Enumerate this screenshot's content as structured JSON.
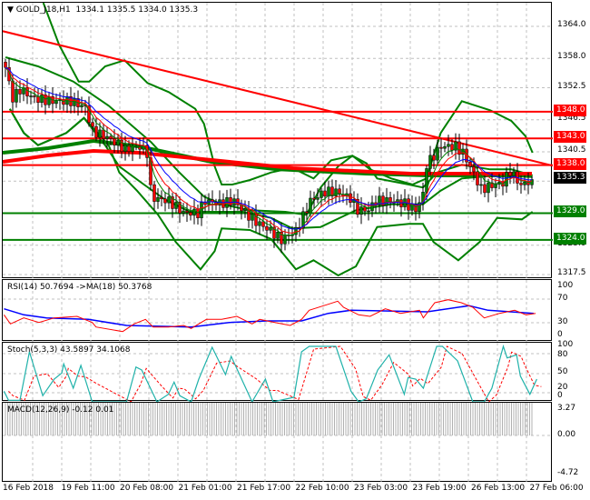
{
  "main": {
    "symbol_title": "GOLD_J18,H1",
    "ohlc": "1334.1 1335.5 1334.0 1335.3",
    "price_ticks": [
      "1364.0",
      "1358.0",
      "1352.5",
      "1346.5",
      "1340.5",
      "1323.0",
      "1317.5"
    ],
    "price_tick_values": [
      1364.0,
      1358.0,
      1352.5,
      1346.5,
      1340.5,
      1323.0,
      1317.5
    ],
    "levels": [
      {
        "label": "1348.0",
        "price": 1348.0,
        "color": "#ff0000"
      },
      {
        "label": "1343.0",
        "price": 1343.0,
        "color": "#ff0000"
      },
      {
        "label": "1338.0",
        "price": 1338.0,
        "color": "#ff0000"
      },
      {
        "label": "1329.0",
        "price": 1329.0,
        "color": "#008000"
      },
      {
        "label": "1324.0",
        "price": 1324.0,
        "color": "#008000"
      }
    ],
    "current_price": {
      "label": "1335.3",
      "price": 1335.3,
      "color": "#000000"
    },
    "close_keypoints": [
      [
        0,
        1356.3
      ],
      [
        2,
        1350.5
      ],
      [
        4,
        1352.2
      ],
      [
        8,
        1350.5
      ],
      [
        13,
        1350
      ],
      [
        18,
        1350
      ],
      [
        22,
        1348.8
      ],
      [
        24,
        1344.4
      ],
      [
        28,
        1343.2
      ],
      [
        33,
        1341
      ],
      [
        37,
        1341.5
      ],
      [
        39,
        1340.3
      ],
      [
        40,
        1333.5
      ],
      [
        41,
        1331.8
      ],
      [
        45,
        1331.3
      ],
      [
        49,
        1329.1
      ],
      [
        53,
        1329
      ],
      [
        55,
        1331.3
      ],
      [
        59,
        1330.8
      ],
      [
        63,
        1331.3
      ],
      [
        66,
        1329.1
      ],
      [
        69,
        1327.4
      ],
      [
        73,
        1325.7
      ],
      [
        76,
        1324
      ],
      [
        80,
        1325.7
      ],
      [
        82,
        1328.4
      ],
      [
        84,
        1331.3
      ],
      [
        88,
        1333
      ],
      [
        91,
        1333
      ],
      [
        95,
        1331.8
      ],
      [
        97,
        1329.6
      ],
      [
        100,
        1329.6
      ],
      [
        102,
        1331.3
      ],
      [
        106,
        1331.3
      ],
      [
        110,
        1330.8
      ],
      [
        113,
        1329.6
      ],
      [
        115,
        1332.5
      ],
      [
        116,
        1338.1
      ],
      [
        120,
        1341.5
      ],
      [
        124,
        1341.5
      ],
      [
        126,
        1340.3
      ],
      [
        129,
        1336.4
      ],
      [
        131,
        1333.5
      ],
      [
        134,
        1334.2
      ],
      [
        137,
        1334.7
      ],
      [
        139,
        1336.9
      ],
      [
        142,
        1334.2
      ],
      [
        145,
        1335.3
      ]
    ],
    "colors": {
      "bull": "#008000",
      "bear": "#ff0000",
      "bands": "#008000",
      "trend": "#ff0000"
    }
  },
  "rsi": {
    "title": "RSI(14) 50.7694  ->MA(18) 50.3768",
    "ticks": [
      "100",
      "70",
      "30",
      "0"
    ]
  },
  "stoch": {
    "title": "Stoch(5,3,3) 43.5897 34.1068",
    "ticks": [
      "100",
      "80",
      "50",
      "20",
      "0"
    ]
  },
  "macd": {
    "title": "MACD(12,26,9) -0.12 0.01",
    "ticks": [
      "3.27",
      "0.00",
      "-4.72"
    ]
  },
  "time_axis": [
    "16 Feb 2018",
    "19 Feb 11:00",
    "20 Feb 08:00",
    "21 Feb 01:00",
    "21 Feb 17:00",
    "22 Feb 10:00",
    "23 Feb 03:00",
    "23 Feb 19:00",
    "26 Feb 13:00",
    "27 Feb 06:00"
  ]
}
